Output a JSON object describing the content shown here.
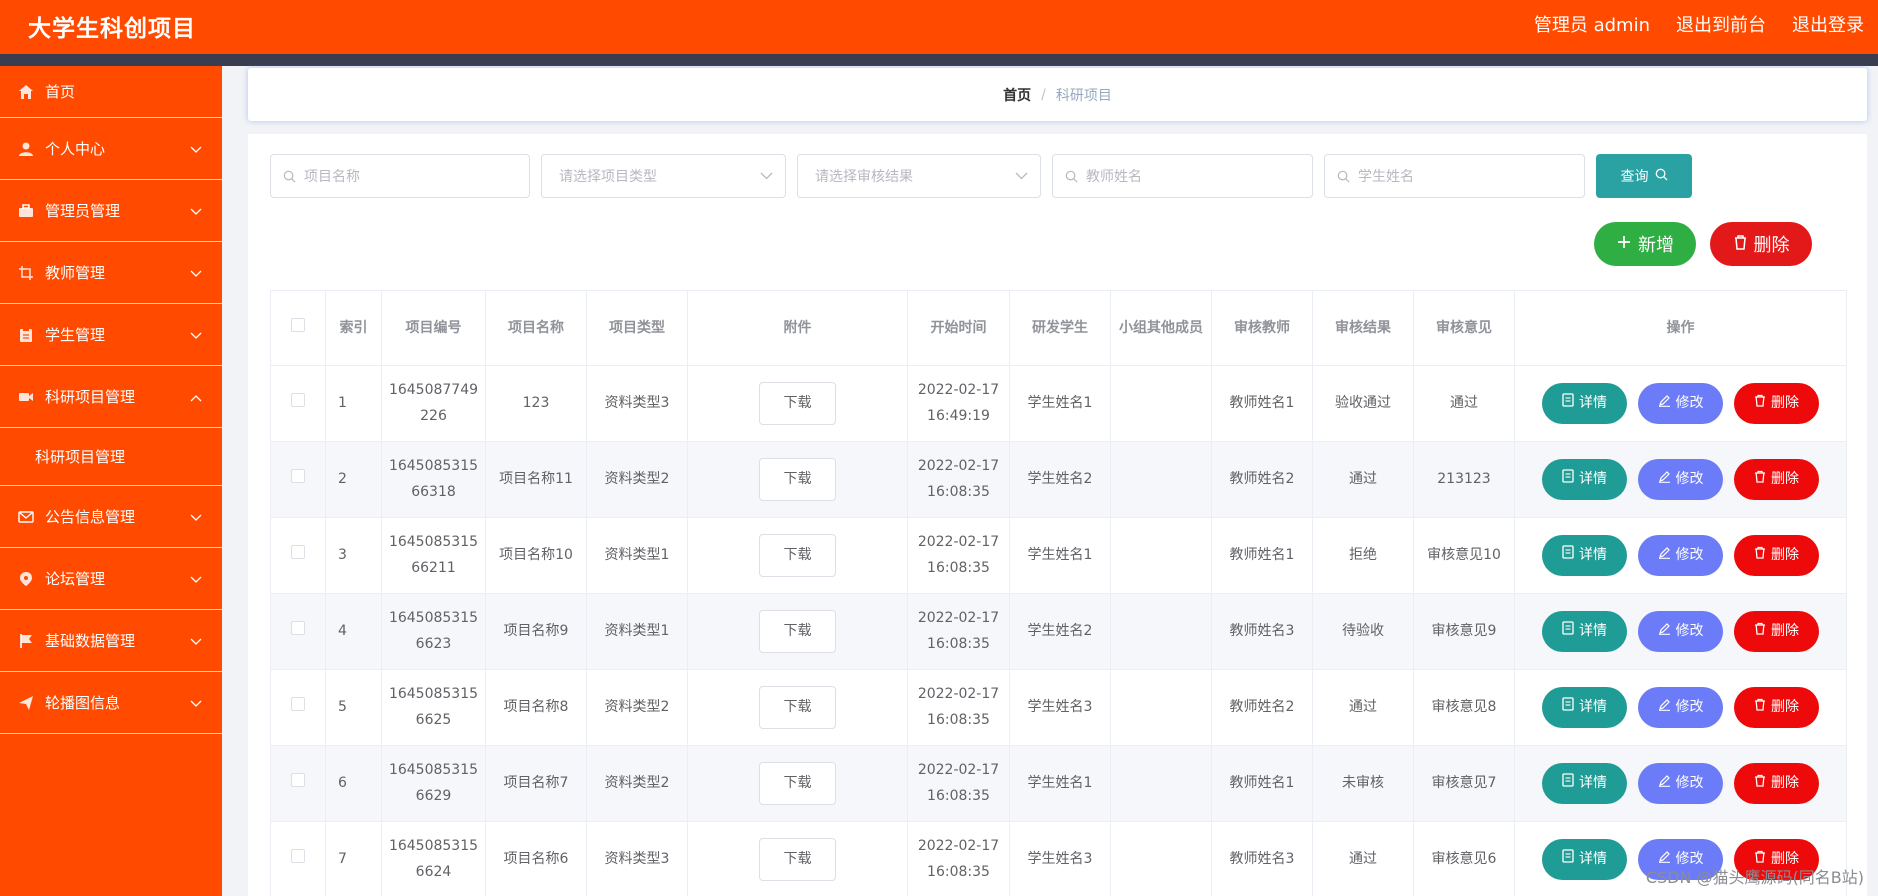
{
  "header": {
    "app_title": "大学生科创项目",
    "links": [
      "管理员 admin",
      "退出到前台",
      "退出登录"
    ]
  },
  "sidebar": {
    "items": [
      {
        "label": "首页",
        "icon": "home-icon"
      },
      {
        "label": "个人中心",
        "icon": "user-icon"
      },
      {
        "label": "管理员管理",
        "icon": "briefcase-icon"
      },
      {
        "label": "教师管理",
        "icon": "crop-icon"
      },
      {
        "label": "学生管理",
        "icon": "clipboard-icon"
      },
      {
        "label": "科研项目管理",
        "icon": "video-icon",
        "expanded": true,
        "sub": "科研项目管理"
      },
      {
        "label": "公告信息管理",
        "icon": "mail-icon"
      },
      {
        "label": "论坛管理",
        "icon": "location-icon"
      },
      {
        "label": "基础数据管理",
        "icon": "flag-icon"
      },
      {
        "label": "轮播图信息",
        "icon": "send-icon"
      }
    ]
  },
  "breadcrumb": {
    "home": "首页",
    "separator": "/",
    "current": "科研项目"
  },
  "search": {
    "project_name_placeholder": "项目名称",
    "project_type_placeholder": "请选择项目类型",
    "review_result_placeholder": "请选择审核结果",
    "teacher_name_placeholder": "教师姓名",
    "student_name_placeholder": "学生姓名",
    "query_label": "查询"
  },
  "actions": {
    "add_label": "新增",
    "delete_label": "删除"
  },
  "table": {
    "headers": [
      "索引",
      "项目编号",
      "项目名称",
      "项目类型",
      "附件",
      "开始时间",
      "研发学生",
      "小组其他成员",
      "审核教师",
      "审核结果",
      "审核意见",
      "操作"
    ],
    "download_label": "下载",
    "op_labels": {
      "detail": "详情",
      "edit": "修改",
      "remove": "删除"
    },
    "rows": [
      {
        "idx": "1",
        "code": "1645087749226",
        "name": "123",
        "type": "资料类型3",
        "start": "2022-02-17 16:49:19",
        "student": "学生姓名1",
        "members": "",
        "teacher": "教师姓名1",
        "result": "验收通过",
        "opinion": "通过"
      },
      {
        "idx": "2",
        "code": "164508531566318",
        "name": "项目名称11",
        "type": "资料类型2",
        "start": "2022-02-17 16:08:35",
        "student": "学生姓名2",
        "members": "",
        "teacher": "教师姓名2",
        "result": "通过",
        "opinion": "213123"
      },
      {
        "idx": "3",
        "code": "164508531566211",
        "name": "项目名称10",
        "type": "资料类型1",
        "start": "2022-02-17 16:08:35",
        "student": "学生姓名1",
        "members": "",
        "teacher": "教师姓名1",
        "result": "拒绝",
        "opinion": "审核意见10"
      },
      {
        "idx": "4",
        "code": "16450853156623",
        "name": "项目名称9",
        "type": "资料类型1",
        "start": "2022-02-17 16:08:35",
        "student": "学生姓名2",
        "members": "",
        "teacher": "教师姓名3",
        "result": "待验收",
        "opinion": "审核意见9"
      },
      {
        "idx": "5",
        "code": "16450853156625",
        "name": "项目名称8",
        "type": "资料类型2",
        "start": "2022-02-17 16:08:35",
        "student": "学生姓名3",
        "members": "",
        "teacher": "教师姓名2",
        "result": "通过",
        "opinion": "审核意见8"
      },
      {
        "idx": "6",
        "code": "16450853156629",
        "name": "项目名称7",
        "type": "资料类型2",
        "start": "2022-02-17 16:08:35",
        "student": "学生姓名1",
        "members": "",
        "teacher": "教师姓名1",
        "result": "未审核",
        "opinion": "审核意见7"
      },
      {
        "idx": "7",
        "code": "16450853156624",
        "name": "项目名称6",
        "type": "资料类型3",
        "start": "2022-02-17 16:08:35",
        "student": "学生姓名3",
        "members": "",
        "teacher": "教师姓名3",
        "result": "通过",
        "opinion": "审核意见6"
      }
    ]
  },
  "watermark": "CSDN @猫头鹰源码(同名B站)"
}
